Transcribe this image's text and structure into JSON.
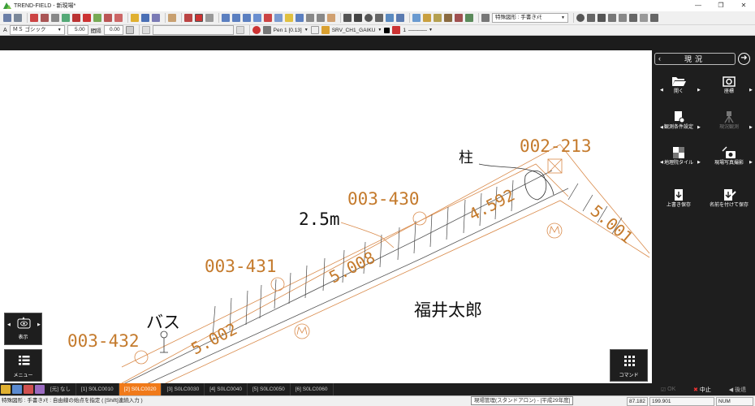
{
  "window": {
    "title": "TREND-FIELD - 新現場*",
    "minimize": "—",
    "maximize": "❐",
    "close": "✕"
  },
  "toolbar1": {
    "special_figure_label": "特殊図形 : 手書きﾒﾓ"
  },
  "toolbar2": {
    "font_name": "ＭＳ ゴシック",
    "font_size": "5.00",
    "spacing_label": "間隔",
    "spacing_value": "0.00",
    "pen": "Pen 1 [0.13]",
    "layer": "SRV_CH1_GAIKU",
    "line_weight": "1"
  },
  "drawing": {
    "parcels": [
      "002-213",
      "003-430",
      "003-431",
      "003-432"
    ],
    "distances": [
      "4.592",
      "5.001",
      "5.008",
      "5.002"
    ],
    "notes": {
      "pillar": "柱",
      "width": "2.5m",
      "bus": "バス",
      "owner": "福井太郎"
    }
  },
  "right_panel": {
    "title": "現況",
    "items": [
      {
        "label": "開く"
      },
      {
        "label": "座標"
      },
      {
        "label": "観測条件設定"
      },
      {
        "label": "現況観測"
      },
      {
        "label": "地理院タイル"
      },
      {
        "label": "現場写真撮影"
      },
      {
        "label": "上書き保存"
      },
      {
        "label": "名前を付けて保存"
      }
    ]
  },
  "floating": {
    "display": "表示",
    "menu": "メニュー",
    "command": "コマンド"
  },
  "tabs": [
    "[元] なし",
    "[1] S0LC0010",
    "[2] S0LC0020",
    "[3] S0LC0030",
    "[4] S0LC0040",
    "[5] S0LC0050",
    "[6] S0LC0060"
  ],
  "active_tab_index": 2,
  "panel_actions": {
    "ok": "OK",
    "cancel": "中止",
    "back": "後退"
  },
  "status": {
    "message": "特殊図形 : 手書きﾒﾓ : 自由線の始点を指定 ( [Shift]連続入力 )",
    "tooltip": "現場管理(スタンドアロン) - [平成29年度]",
    "x": "87.182",
    "y": "199.901",
    "num": "NUM"
  },
  "colors": {
    "accent_orange": "#f07a1a",
    "parcel_text": "#c47a2c",
    "line_orange": "#d98a4a",
    "panel_bg": "#1e1e1e"
  }
}
